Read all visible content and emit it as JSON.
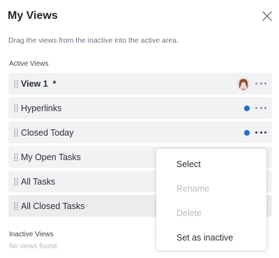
{
  "dialog": {
    "title": "My Views",
    "subtitle": "Drag the views from the inactive into the active area."
  },
  "active_section": {
    "label": "Active Views",
    "views": [
      {
        "label": "View 1  *",
        "bold": true,
        "indicator": "avatar",
        "more_dark": false
      },
      {
        "label": "Hyperlinks",
        "bold": false,
        "indicator": "dot",
        "more_dark": false
      },
      {
        "label": "Closed Today",
        "bold": false,
        "indicator": "dot",
        "more_dark": true
      },
      {
        "label": "My Open Tasks",
        "bold": false,
        "indicator": "none",
        "more_dark": false
      },
      {
        "label": "All Tasks",
        "bold": false,
        "indicator": "none",
        "more_dark": false
      },
      {
        "label": "All Closed Tasks",
        "bold": false,
        "indicator": "none",
        "more_dark": false
      }
    ]
  },
  "inactive_section": {
    "label": "Inactive Views",
    "empty_text": "No views found."
  },
  "context_menu": {
    "items": [
      {
        "label": "Select",
        "enabled": true
      },
      {
        "label": "Rename",
        "enabled": false
      },
      {
        "label": "Delete",
        "enabled": false
      },
      {
        "label": "Set as inactive",
        "enabled": true
      }
    ]
  },
  "colors": {
    "accent_dot": "#1f6fc5",
    "row_bg": "#f1f2f4",
    "disabled_text": "#b9bdc4"
  },
  "icons": {
    "close": "close-icon",
    "drag": "drag-handle-icon",
    "more": "more-horizontal-icon",
    "avatar": "user-avatar"
  }
}
